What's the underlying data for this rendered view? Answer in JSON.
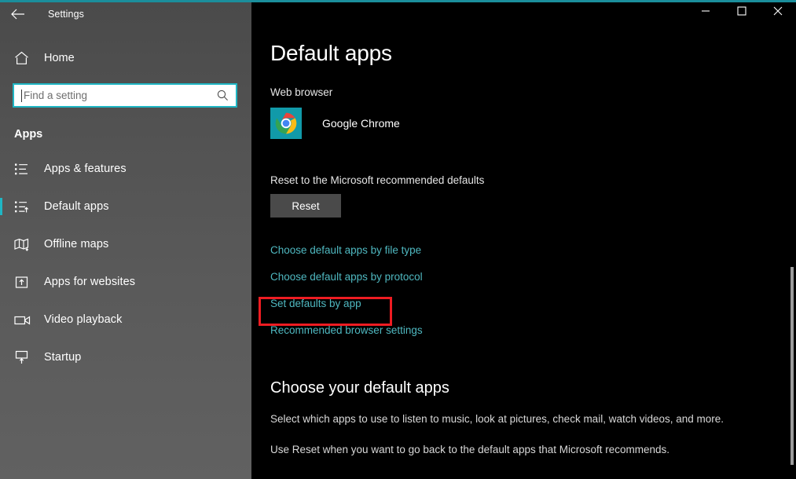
{
  "window": {
    "accent_color": "#1b8e9c",
    "controls": [
      {
        "name": "minimize",
        "glyph": "minimize-icon"
      },
      {
        "name": "maximize",
        "glyph": "maximize-icon"
      },
      {
        "name": "close",
        "glyph": "close-icon"
      }
    ]
  },
  "sidebar": {
    "back_label": "back-arrow-icon",
    "app_title": "Settings",
    "home": {
      "label": "Home",
      "icon": "home-icon"
    },
    "search": {
      "placeholder": "Find a setting",
      "value": "",
      "icon": "search-icon",
      "border_color": "#1fb6c4"
    },
    "group_header": "Apps",
    "items": [
      {
        "label": "Apps & features",
        "icon": "list-icon",
        "selected": false
      },
      {
        "label": "Default apps",
        "icon": "list-arrow-icon",
        "selected": true
      },
      {
        "label": "Offline maps",
        "icon": "map-download-icon",
        "selected": false
      },
      {
        "label": "Apps for websites",
        "icon": "box-arrow-up-icon",
        "selected": false
      },
      {
        "label": "Video playback",
        "icon": "video-camera-icon",
        "selected": false
      },
      {
        "label": "Startup",
        "icon": "monitor-arrow-icon",
        "selected": false
      }
    ],
    "selected_indicator_color": "#1fb6c4"
  },
  "main": {
    "page_title": "Default apps",
    "web_browser_label": "Web browser",
    "default_browser": {
      "name": "Google Chrome",
      "icon": "chrome-icon",
      "tile_color": "#119aa9"
    },
    "reset_label": "Reset to the Microsoft recommended defaults",
    "reset_button": "Reset",
    "links": [
      {
        "label": "Choose default apps by file type",
        "highlighted": false
      },
      {
        "label": "Choose default apps by protocol",
        "highlighted": false
      },
      {
        "label": "Set defaults by app",
        "highlighted": true
      },
      {
        "label": "Recommended browser settings",
        "highlighted": false
      }
    ],
    "link_color": "#4fb8c0",
    "highlight_color": "#ee1c22",
    "sub_heading": "Choose your default apps",
    "paragraphs": [
      "Select which apps to use to listen to music, look at pictures, check mail, watch videos, and more.",
      "Use Reset when you want to go back to the default apps that Microsoft recommends."
    ]
  }
}
